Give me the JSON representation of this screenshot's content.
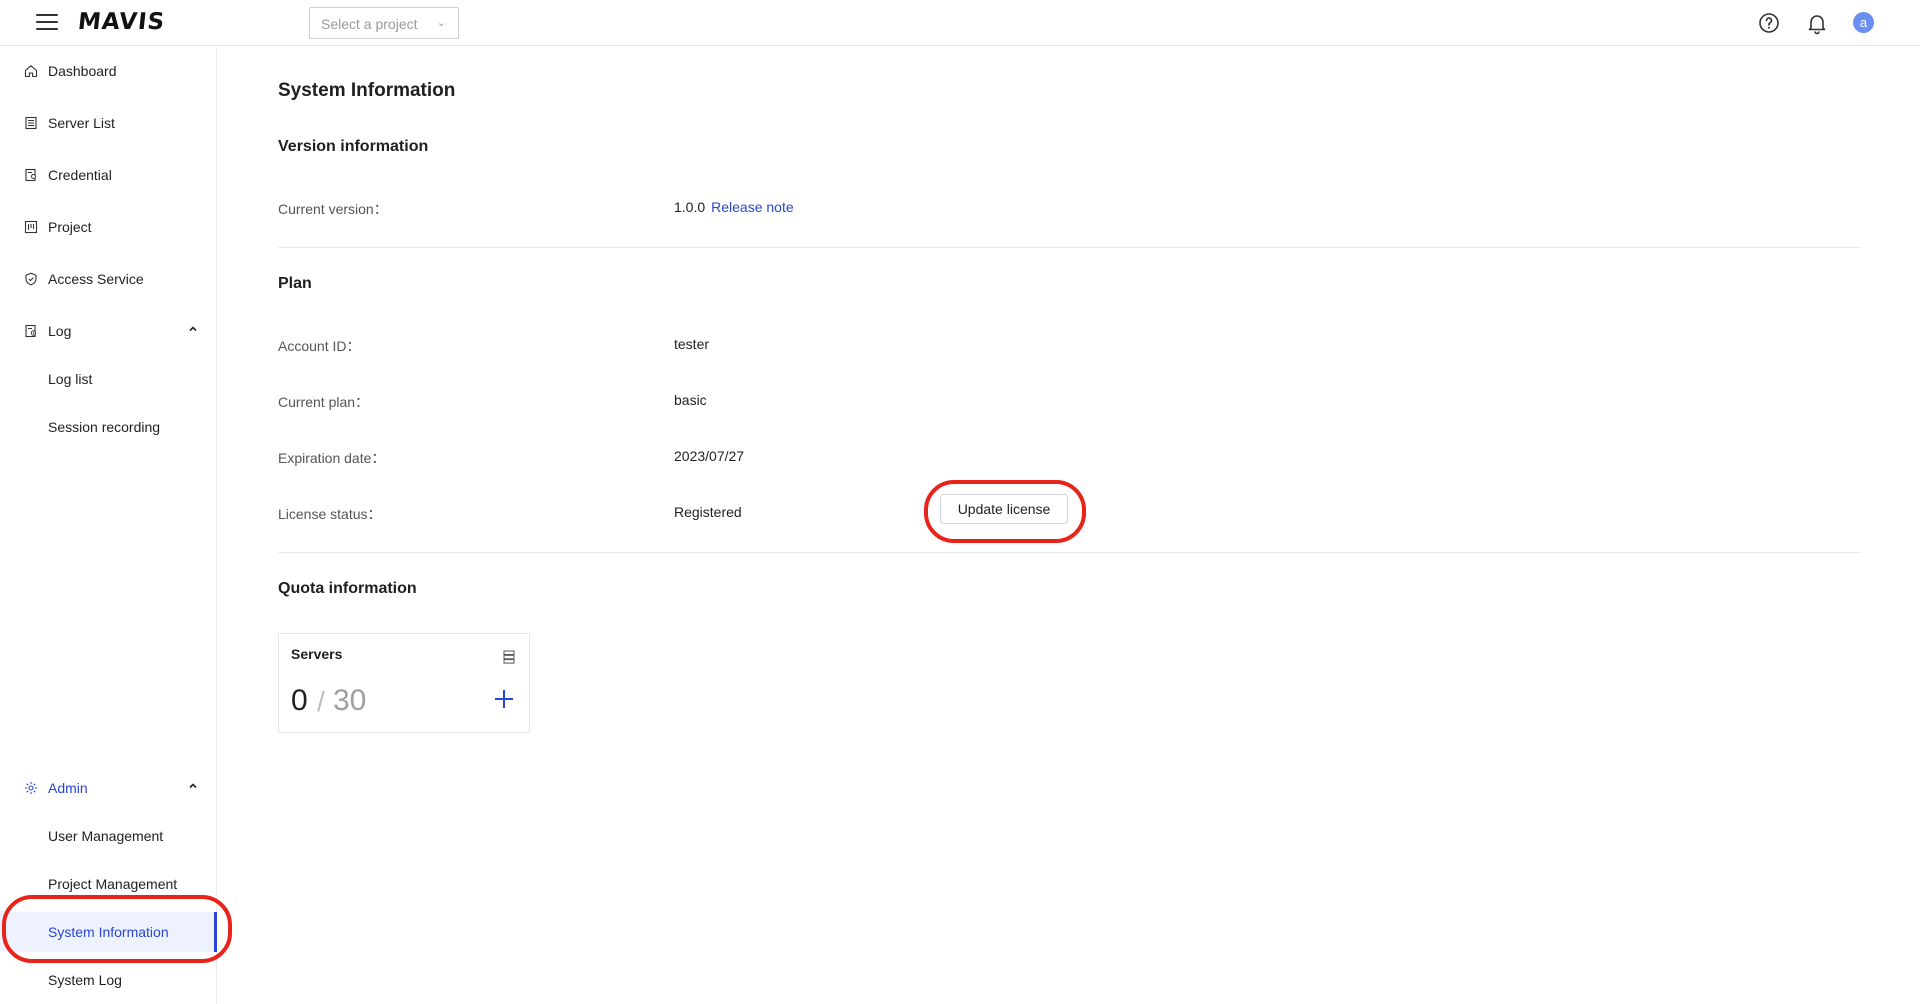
{
  "header": {
    "logo": "MAVIS",
    "project_select_placeholder": "Select a project",
    "avatar_letter": "a"
  },
  "sidebar": {
    "items": [
      {
        "label": "Dashboard",
        "icon": "home-icon"
      },
      {
        "label": "Server List",
        "icon": "server-list-icon"
      },
      {
        "label": "Credential",
        "icon": "credential-icon"
      },
      {
        "label": "Project",
        "icon": "project-icon"
      },
      {
        "label": "Access Service",
        "icon": "shield-icon"
      },
      {
        "label": "Log",
        "icon": "log-icon",
        "expanded": true
      },
      {
        "label": "Log list"
      },
      {
        "label": "Session recording"
      },
      {
        "label": "Admin",
        "icon": "gear-icon",
        "expanded": true
      },
      {
        "label": "User Management"
      },
      {
        "label": "Project Management"
      },
      {
        "label": "System Information",
        "active": true
      },
      {
        "label": "System Log"
      }
    ]
  },
  "main": {
    "title": "System Information",
    "version_section": {
      "title": "Version information",
      "current_version_label": "Current version：",
      "current_version_value": "1.0.0",
      "release_note_link": "Release note"
    },
    "plan_section": {
      "title": "Plan",
      "account_id_label": "Account ID：",
      "account_id_value": "tester",
      "current_plan_label": "Current plan：",
      "current_plan_value": "basic",
      "expiration_label": "Expiration date：",
      "expiration_value": "2023/07/27",
      "license_label": "License status：",
      "license_value": "Registered",
      "update_button": "Update license"
    },
    "quota_section": {
      "title": "Quota information",
      "card_title": "Servers",
      "used": "0",
      "separator": "/",
      "total": "30"
    }
  },
  "colors": {
    "accent": "#2a45d0",
    "highlight": "#e8231a",
    "avatar": "#6b8ff0"
  }
}
